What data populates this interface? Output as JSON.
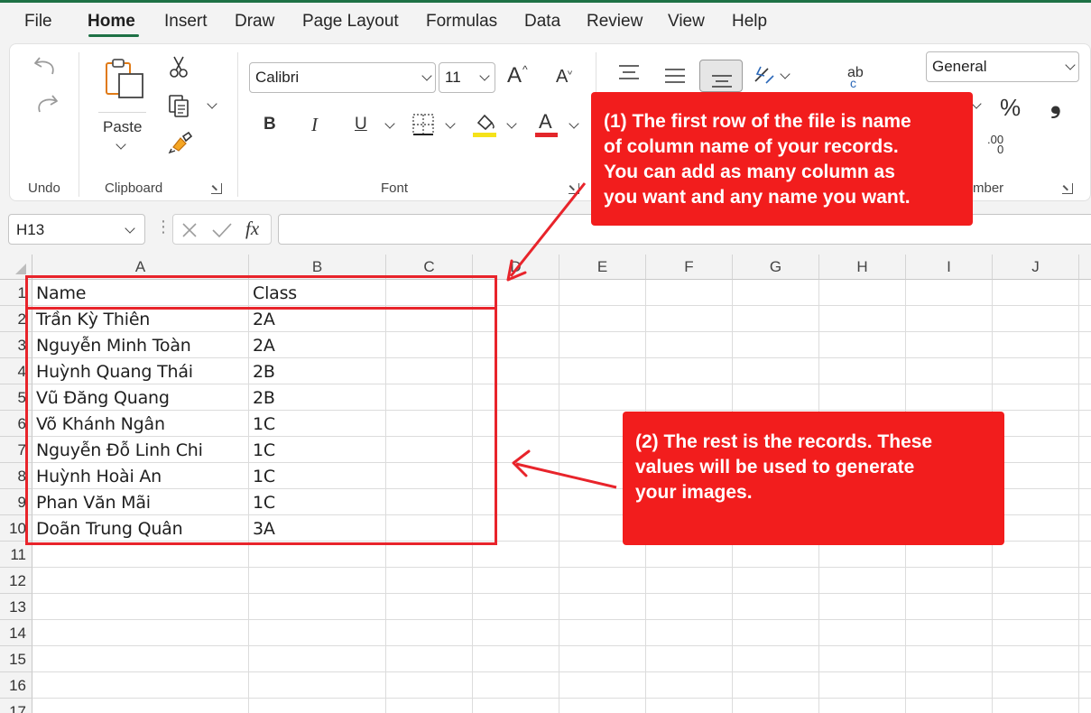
{
  "menu": {
    "tabs": [
      "File",
      "Home",
      "Insert",
      "Draw",
      "Page Layout",
      "Formulas",
      "Data",
      "Review",
      "View",
      "Help"
    ],
    "active": "Home"
  },
  "ribbon": {
    "groups": {
      "undo": "Undo",
      "clipboard": "Clipboard",
      "font": "Font",
      "number": "mber"
    },
    "paste_label": "Paste",
    "font_name": "Calibri",
    "font_size": "11",
    "number_format": "General",
    "grow_font": "A",
    "shrink_font": "A",
    "bold": "B",
    "italic": "I",
    "underline": "U",
    "font_color_letter": "A",
    "percent": "%",
    "comma": "❟",
    "decimal": ".00",
    "decimal2": "0",
    "wrap_text_top": "ab",
    "wrap_text_bottom": "c"
  },
  "formula_bar": {
    "name_box": "H13",
    "fx": "fx",
    "value": ""
  },
  "columns": [
    "A",
    "B",
    "C",
    "D",
    "E",
    "F",
    "G",
    "H",
    "I",
    "J"
  ],
  "rows": [
    "1",
    "2",
    "3",
    "4",
    "5",
    "6",
    "7",
    "8",
    "9",
    "10",
    "11",
    "12",
    "13",
    "14",
    "15",
    "16",
    "17"
  ],
  "sheet": {
    "header": [
      "Name",
      "Class"
    ],
    "records": [
      [
        "Trần Kỳ Thiên",
        "2A"
      ],
      [
        "Nguyễn Minh Toàn",
        "2A"
      ],
      [
        "Huỳnh Quang Thái",
        "2B"
      ],
      [
        "Vũ Đăng Quang",
        "2B"
      ],
      [
        "Võ Khánh Ngân",
        "1C"
      ],
      [
        "Nguyễn Đỗ Linh Chi",
        "1C"
      ],
      [
        "Huỳnh Hoài An",
        "1C"
      ],
      [
        "Phan Văn Mãi",
        "1C"
      ],
      [
        "Doãn Trung Quân",
        "3A"
      ]
    ]
  },
  "annotations": {
    "callout1": [
      "(1) The first row of the file is name",
      "of column name of your records.",
      "You can add as many column as",
      "you want and any name you want."
    ],
    "callout2": [
      "(2) The rest is the records. These",
      "values will be used to generate",
      "your images."
    ],
    "color": "#f21d1d"
  },
  "colors": {
    "excel_green": "#1e7145",
    "ribbon_bg": "#f3f3f3",
    "highlight_yellow": "#f5e21a",
    "font_red": "#e3262b"
  }
}
